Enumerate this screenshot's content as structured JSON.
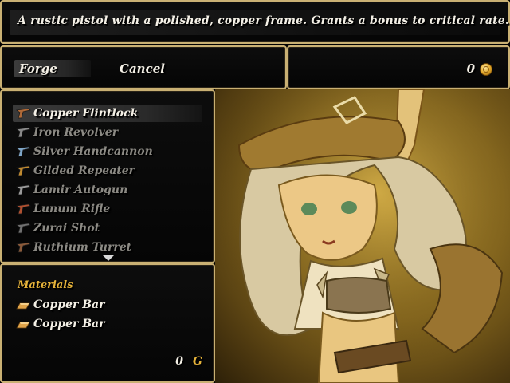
{
  "help": {
    "text": "A rustic pistol with a polished, copper frame. Grants a bonus to critical rate."
  },
  "commands": {
    "forge": "Forge",
    "cancel": "Cancel"
  },
  "gold": {
    "amount": "0"
  },
  "weapons": [
    {
      "name": "Copper Flintlock",
      "enabled": true,
      "icon": "pistol-icon",
      "color": "#b06a38"
    },
    {
      "name": "Iron Revolver",
      "enabled": false,
      "icon": "revolver-icon",
      "color": "#8a8a8a"
    },
    {
      "name": "Silver Handcannon",
      "enabled": false,
      "icon": "handcannon-icon",
      "color": "#7fa6c8"
    },
    {
      "name": "Gilded Repeater",
      "enabled": false,
      "icon": "repeater-icon",
      "color": "#c08a30"
    },
    {
      "name": "Lamir Autogun",
      "enabled": false,
      "icon": "autogun-icon",
      "color": "#9a9a9a"
    },
    {
      "name": "Lunum Rifle",
      "enabled": false,
      "icon": "rifle-icon",
      "color": "#b05030"
    },
    {
      "name": "Zurai Shot",
      "enabled": false,
      "icon": "shot-icon",
      "color": "#707070"
    },
    {
      "name": "Ruthium Turret",
      "enabled": false,
      "icon": "turret-icon",
      "color": "#8a5a3a"
    }
  ],
  "materials": {
    "title": "Materials",
    "items": [
      {
        "name": "Copper Bar",
        "icon": "ingot-icon"
      },
      {
        "name": "Copper Bar",
        "icon": "ingot-icon"
      }
    ],
    "cost": "0",
    "currency": "G"
  },
  "colors": {
    "frame": "#c9b073",
    "accent": "#e6b33a"
  }
}
